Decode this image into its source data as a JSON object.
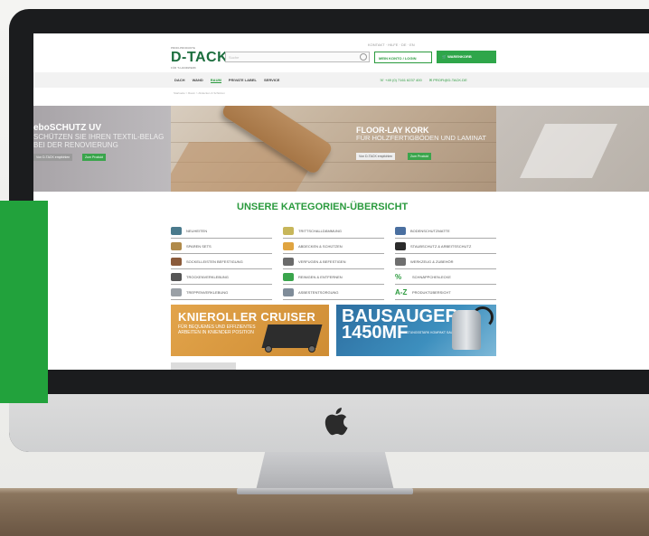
{
  "site": {
    "top_links": "KONTAKT · HILFE · DE · EN",
    "logo_top": "PROFI-PRODUKTE",
    "logo": "D-TACK",
    "logo_sub": "FÜR 'S HANDWERK",
    "search_placeholder": "Suche",
    "account_label": "MEIN KONTO / LOGIN",
    "cart_label": "WARENKORB"
  },
  "nav": {
    "items": [
      "DACH",
      "WAND",
      "RAUM",
      "PRIVATE LABEL",
      "SERVICE"
    ],
    "active_index": 2,
    "phone": "+49 (0) 7161 6237 400",
    "email": "PROFI@D-TACK.DE"
  },
  "breadcrumb": "Startseite > Raum > Abdecken & Schützen",
  "banners": {
    "left": {
      "title": "eboSCHUTZ UV",
      "subtitle": "SCHÜTZEN SIE IHREN TEXTIL-BELAG BEI DER RENOVIERUNG",
      "btn_secondary": "Von D-TACK empfohlen",
      "btn_primary": "Zum Produkt"
    },
    "main": {
      "title": "FLOOR-LAY KORK",
      "subtitle": "FÜR HOLZFERTIGBÖDEN UND LAMINAT",
      "btn_secondary": "Von D-TACK empfohlen",
      "btn_primary": "Zum Produkt"
    }
  },
  "categories": {
    "title": "UNSERE KATEGORIEN-ÜBERSICHT",
    "col1": [
      "NEUHEITEN",
      "SPAREN SETS",
      "SOCKELLEISTEN BEFESTIGUNG",
      "TROCKENVERKLEBUNG",
      "TREPPENVERKLEBUNG"
    ],
    "col2": [
      "TRITTSCHALLDÄMMUNG",
      "ABDECKEN & SCHÜTZEN",
      "VERFUGEN & BEFESTIGEN",
      "REINIGEN & ENTFERNEN",
      "ASBESTENTSORGUNG"
    ],
    "col3": [
      "BODENSCHUTZMATTE",
      "STAUBSCHUTZ & ARBEITSSCHUTZ",
      "WERKZEUG & ZUBEHÖR",
      "SCHNÄPPCHEN-ECKE",
      "PRODUKTÜBERSICHT"
    ],
    "col3_icons": [
      "",
      "",
      "",
      "%",
      "A-Z"
    ],
    "colors": {
      "col1": [
        "#4a7a8c",
        "#b08a4a",
        "#8a5a3a",
        "#555555",
        "#9aa0a6"
      ],
      "col2": [
        "#c7b65a",
        "#e0a440",
        "#6a6a6a",
        "#3aa54c",
        "#7f8c99"
      ],
      "col3": [
        "#4a6fa0",
        "#2b2b2b",
        "#6e6e6e",
        "#ffffff",
        "#ffffff"
      ]
    }
  },
  "promos": {
    "left": {
      "title": "KNIEROLLER CRUISER",
      "subtitle": "FÜR BEQUEMES UND EFFIZIENTES ARBEITEN IN KNIENDER POSITION"
    },
    "right": {
      "title_line1": "BAUSAUGER",
      "title_line2": "1450MF",
      "subtitle": "LEISTUNGSSTARK KOMPAKT SAUBER"
    }
  },
  "colors": {
    "brand_green": "#2a9a3d",
    "accent_green_panel": "#22a23c"
  }
}
